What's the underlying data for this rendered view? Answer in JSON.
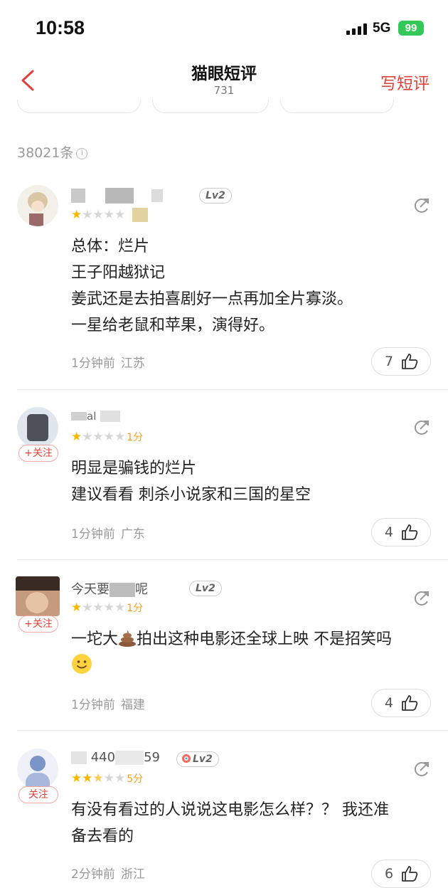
{
  "status": {
    "time": "10:58",
    "network": "5G",
    "battery": "99"
  },
  "nav": {
    "title": "猫眼短评",
    "count": "731",
    "write_label": "写短评"
  },
  "total": {
    "count_label": "38021条"
  },
  "reviews": [
    {
      "username_fragment": "",
      "level": "Lv2",
      "score": "",
      "lines": [
        "总体：烂片",
        "王子阳越狱记",
        "姜武还是去拍喜剧好一点再加全片寡淡。",
        "一星给老鼠和苹果，演得好。"
      ],
      "time": "1分钟前",
      "location": "江苏",
      "likes": "7"
    },
    {
      "username_fragment": "al",
      "follow_label": "+关注",
      "score": "1分",
      "lines": [
        "明显是骗钱的烂片",
        "建议看看  刺杀小说家和三国的星空"
      ],
      "time": "1分钟前",
      "location": "广东",
      "likes": "4"
    },
    {
      "username_fragment": "今天要",
      "username_suffix": "呢",
      "level": "Lv2",
      "follow_label": "+关注",
      "score": "1分",
      "lines": [
        "一坨大",
        "拍出这种电影还全球上映 不是招笑吗"
      ],
      "time": "1分钟前",
      "location": "福建",
      "likes": "4"
    },
    {
      "username_fragment": "440",
      "username_suffix": "59",
      "level": "Lv2",
      "follow_label": "关注",
      "score": "5分",
      "lines": [
        "有没有看过的人说说这电影怎么样？？ 我还准",
        "备去看的"
      ],
      "time": "2分钟前",
      "location": "浙江",
      "likes": "6"
    }
  ],
  "colors": {
    "accent": "#e0423b",
    "star": "#f7b500",
    "battery": "#34c759"
  }
}
